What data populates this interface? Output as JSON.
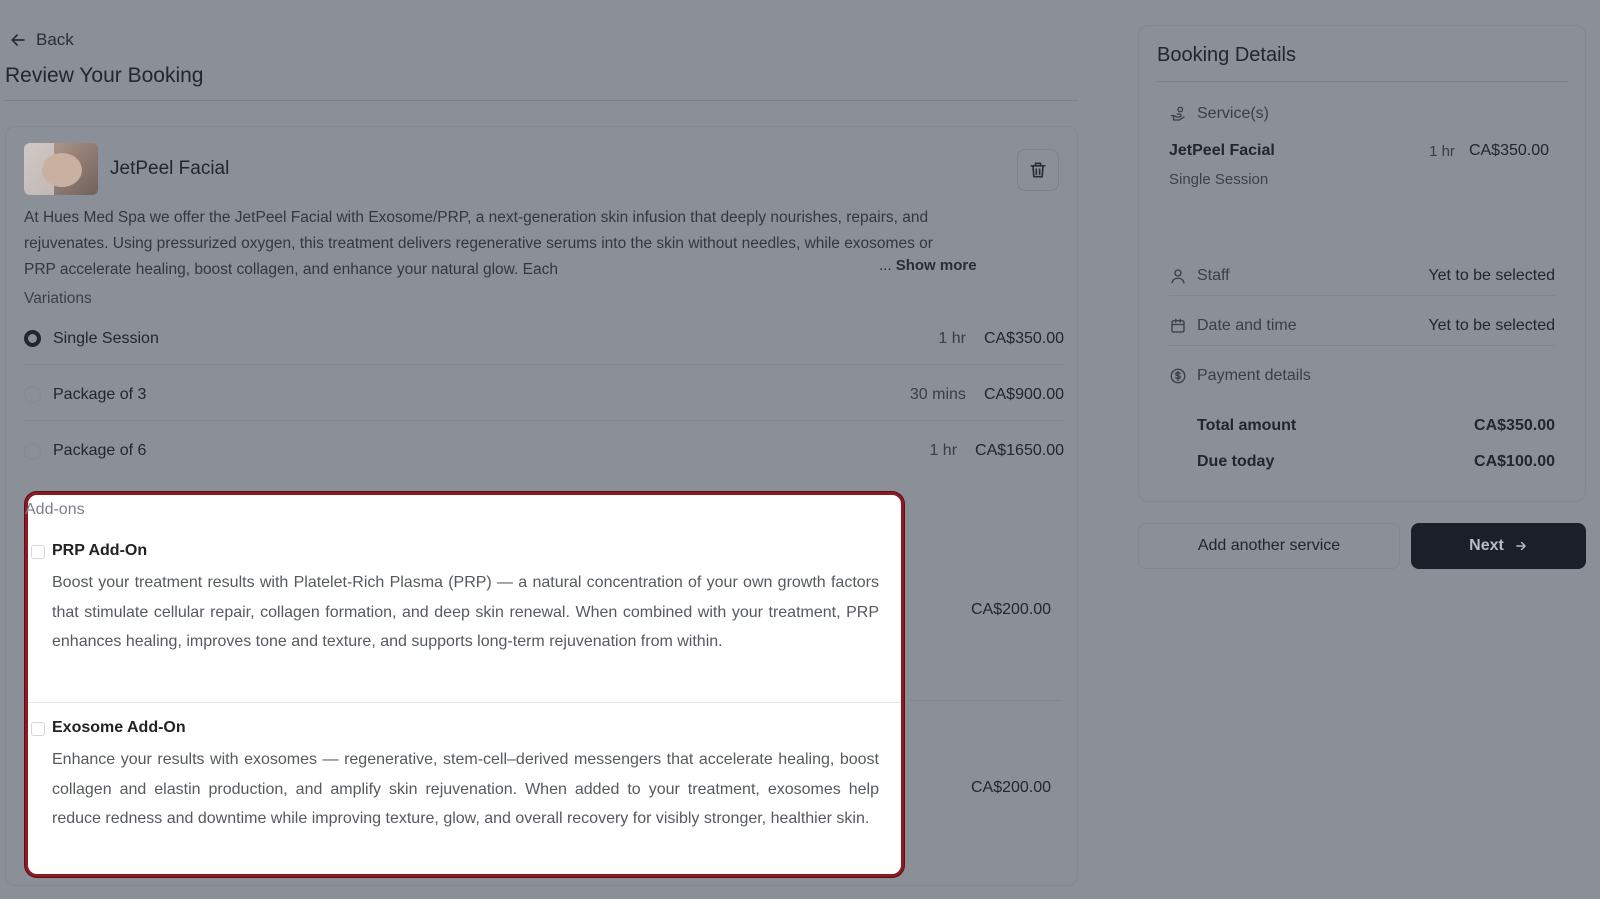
{
  "nav": {
    "back_label": "Back"
  },
  "page": {
    "title": "Review Your Booking"
  },
  "service": {
    "name": "JetPeel Facial",
    "description": "At Hues Med Spa we offer the JetPeel Facial with Exosome/PRP, a next-generation skin infusion that deeply nourishes, repairs, and rejuvenates. Using pressurized oxygen, this treatment delivers regenerative serums into the skin without needles, while exosomes or PRP accelerate healing, boost collagen, and enhance your natural glow. Each",
    "show_more_prefix": "...",
    "show_more_label": "Show more",
    "variations_label": "Variations",
    "variations": [
      {
        "name": "Single Session",
        "duration": "1 hr",
        "price": "CA$350.00",
        "selected": true
      },
      {
        "name": "Package of 3",
        "duration": "30 mins",
        "price": "CA$900.00",
        "selected": false
      },
      {
        "name": "Package of 6",
        "duration": "1 hr",
        "price": "CA$1650.00",
        "selected": false
      }
    ]
  },
  "addons": {
    "title": "Add-ons",
    "items": [
      {
        "name": "PRP Add-On",
        "description": "Boost your treatment results with Platelet-Rich Plasma (PRP) — a natural concentration of your own growth factors that stimulate cellular repair, collagen formation, and deep skin renewal. When combined with your treatment, PRP enhances healing, improves tone and texture, and supports long-term rejuvenation from within.",
        "price": "CA$200.00"
      },
      {
        "name": "Exosome Add-On",
        "description": "Enhance your results with exosomes — regenerative, stem-cell–derived messengers that accelerate healing, boost collagen and elastin production, and amplify skin rejuvenation. When added to your treatment, exosomes help reduce redness and downtime while improving texture, glow, and overall recovery for visibly stronger, healthier skin.",
        "price": "CA$200.00"
      }
    ]
  },
  "booking": {
    "title": "Booking Details",
    "services_label": "Service(s)",
    "service_name": "JetPeel Facial",
    "service_duration": "1 hr",
    "service_price": "CA$350.00",
    "service_variation": "Single Session",
    "staff_label": "Staff",
    "staff_value": "Yet to be selected",
    "datetime_label": "Date and time",
    "datetime_value": "Yet to be selected",
    "payment_label": "Payment details",
    "total_label": "Total amount",
    "total_value": "CA$350.00",
    "due_label": "Due today",
    "due_value": "CA$100.00"
  },
  "actions": {
    "add_another_label": "Add another service",
    "next_label": "Next"
  },
  "colors": {
    "highlight_border": "#8b1a24",
    "primary_button": "#1b1f2a",
    "overlay": "#8b8f97"
  }
}
